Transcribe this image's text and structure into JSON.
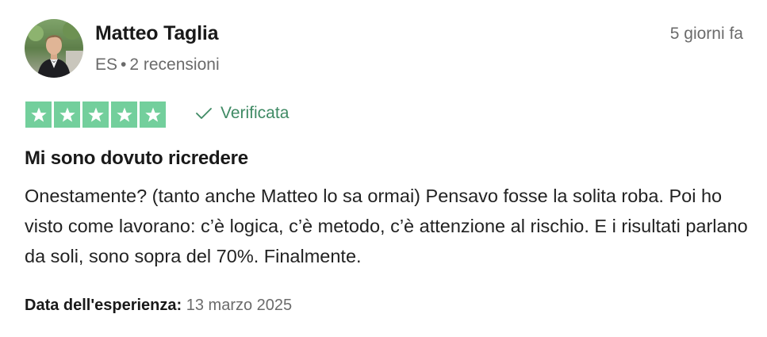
{
  "reviewer": {
    "name": "Matteo Taglia",
    "country": "ES",
    "separator": "•",
    "review_count": "2 recensioni"
  },
  "posted": "5 giorni fa",
  "rating": {
    "stars": 5,
    "max": 5,
    "star_color": "#73cf9c"
  },
  "verified": {
    "label": "Verificata",
    "icon": "check-icon"
  },
  "review": {
    "title": "Mi sono dovuto ricredere",
    "body": "Onestamente? (tanto anche Matteo lo sa ormai) Pensavo fosse la solita roba. Poi ho visto come lavorano: c’è logica, c’è metodo, c’è attenzione al rischio. E i risultati parlano da soli, sono sopra del 70%. Finalmente."
  },
  "experience": {
    "label": "Data dell'esperienza:",
    "date": "13 marzo 2025"
  }
}
